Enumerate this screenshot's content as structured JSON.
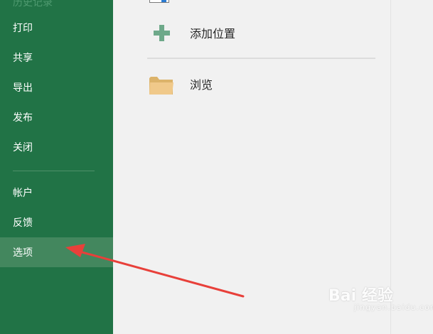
{
  "sidebar": {
    "top_partial": "历史记录",
    "items": [
      {
        "label": "打印"
      },
      {
        "label": "共享"
      },
      {
        "label": "导出"
      },
      {
        "label": "发布"
      },
      {
        "label": "关闭"
      },
      {
        "label": "帐户"
      },
      {
        "label": "反馈"
      },
      {
        "label": "选项",
        "active": true
      }
    ]
  },
  "main": {
    "places": [
      {
        "label": "添加位置",
        "icon": "plus-icon"
      },
      {
        "label": "浏览",
        "icon": "folder-icon"
      }
    ]
  },
  "watermark": {
    "text": "Bai 经验",
    "sub": "jingyan.baidu.com"
  },
  "colors": {
    "sidebar_bg": "#217346",
    "sidebar_active": "#43875e",
    "main_bg": "#f1f1f1",
    "annotation_arrow": "#e8403a"
  }
}
